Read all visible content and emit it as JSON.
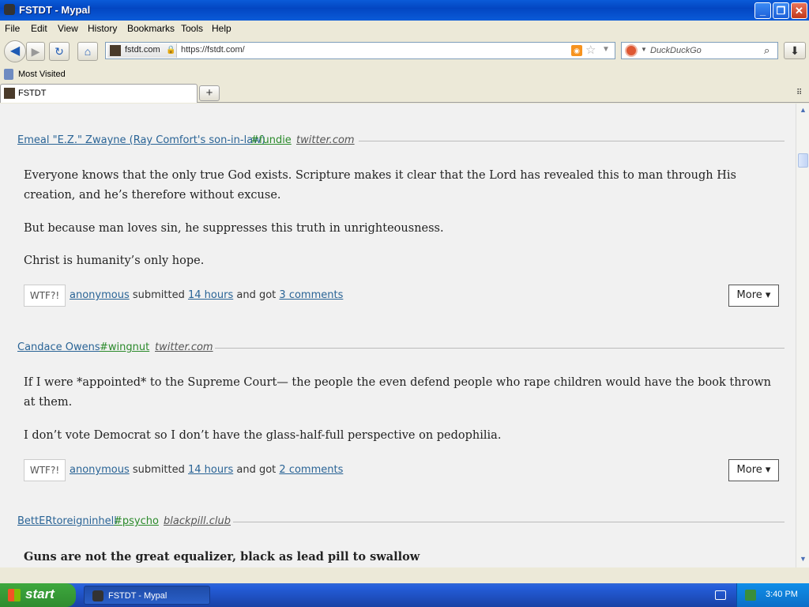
{
  "window": {
    "title": "FSTDT - Mypal"
  },
  "menu": {
    "file": "File",
    "edit": "Edit",
    "view": "View",
    "history": "History",
    "bookmarks": "Bookmarks",
    "tools": "Tools",
    "help": "Help"
  },
  "nav": {
    "domain": "fstdt.com",
    "url": "https://fstdt.com/",
    "search_placeholder": "DuckDuckGo"
  },
  "bookmarks_toolbar": {
    "most_visited": "Most Visited"
  },
  "tabs": [
    {
      "title": "FSTDT"
    }
  ],
  "posts": [
    {
      "author": "Emeal \"E.Z.\" Zwayne (Ray Comfort's son-in-law)",
      "tag": "#fundie",
      "source": "twitter.com",
      "paragraphs": [
        "Everyone knows that the only true God exists. Scripture makes it clear that the Lord has revealed this to man through His creation, and he’s therefore without excuse.",
        "But because man loves sin, he suppresses this truth in unrighteousness.",
        "Christ is humanity’s only hope."
      ],
      "wtf": "WTF?!",
      "submitter": "anonymous",
      "submitted_text": "submitted",
      "time": "14 hours",
      "got_text": "and got",
      "comments": "3 comments",
      "more": "More ▾"
    },
    {
      "author": "Candace Owens",
      "tag": "#wingnut",
      "source": "twitter.com",
      "paragraphs": [
        "If I were *appointed* to the Supreme Court— the people the even defend people who rape children would have the book thrown at them.",
        "I don’t vote Democrat so I don’t have the glass-half-full perspective on pedophilia."
      ],
      "wtf": "WTF?!",
      "submitter": "anonymous",
      "submitted_text": "submitted",
      "time": "14 hours",
      "got_text": "and got",
      "comments": "2 comments",
      "more": "More ▾"
    },
    {
      "author": "BettERtoreigninhell",
      "tag": "#psycho",
      "source": "blackpill.club",
      "paragraphs": [
        "Guns are not the great equalizer, black as lead pill to swallow"
      ]
    }
  ],
  "taskbar": {
    "start": "start",
    "task_label": "FSTDT - Mypal",
    "clock": "3:40 PM"
  }
}
